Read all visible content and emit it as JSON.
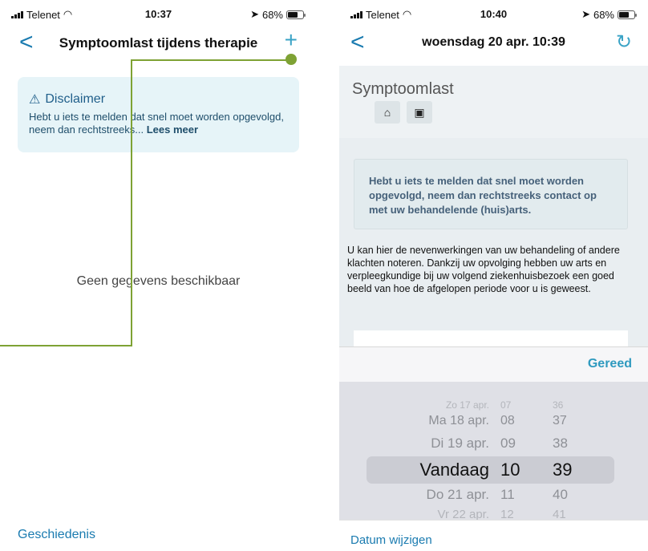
{
  "left": {
    "status": {
      "carrier": "Telenet",
      "time": "10:37",
      "battery": "68%"
    },
    "nav": {
      "back": "<",
      "title": "Symptoomlast tijdens therapie",
      "add": "+"
    },
    "disclaimer": {
      "title": "Disclaimer",
      "text": "Hebt u iets te melden dat snel moet worden opgevolgd, neem dan rechtstreeks...",
      "more": "Lees meer"
    },
    "empty": "Geen gegevens beschikbaar",
    "history": "Geschiedenis"
  },
  "right": {
    "status": {
      "carrier": "Telenet",
      "time": "10:40",
      "battery": "68%"
    },
    "nav": {
      "back": "<",
      "title": "woensdag 20 apr. 10:39"
    },
    "section_title": "Symptoomlast",
    "info_card": "Hebt u iets te melden dat snel moet worden opgevolgd, neem dan rechtstreeks contact op met uw behandelende (huis)arts.",
    "paragraph": "U kan hier de nevenwerkingen van uw behandeling of andere klachten noteren. Dankzij uw opvolging hebben uw arts en verpleegkundige bij uw volgend ziekenhuisbezoek een goed beeld van hoe de afgelopen periode voor u is geweest.",
    "done": "Gereed",
    "picker": {
      "rows": [
        {
          "date": "Zo 17 apr.",
          "hour": "07",
          "minute": "36"
        },
        {
          "date": "Ma 18 apr.",
          "hour": "08",
          "minute": "37"
        },
        {
          "date": "Di 19 apr.",
          "hour": "09",
          "minute": "38"
        },
        {
          "date": "Vandaag",
          "hour": "10",
          "minute": "39",
          "selected": true
        },
        {
          "date": "Do 21 apr.",
          "hour": "11",
          "minute": "40"
        },
        {
          "date": "Vr 22 apr.",
          "hour": "12",
          "minute": "41"
        }
      ]
    },
    "change_date": "Datum wijzigen"
  },
  "colors": {
    "accent": "#1a7bb0",
    "annotation": "#7ea234",
    "disclaimer_bg": "#e6f4f8"
  },
  "icons": [
    "signal-icon",
    "wifi-icon",
    "location-icon",
    "battery-icon",
    "back-chevron-icon",
    "plus-icon",
    "warning-icon",
    "refresh-icon",
    "home-icon",
    "save-icon"
  ]
}
